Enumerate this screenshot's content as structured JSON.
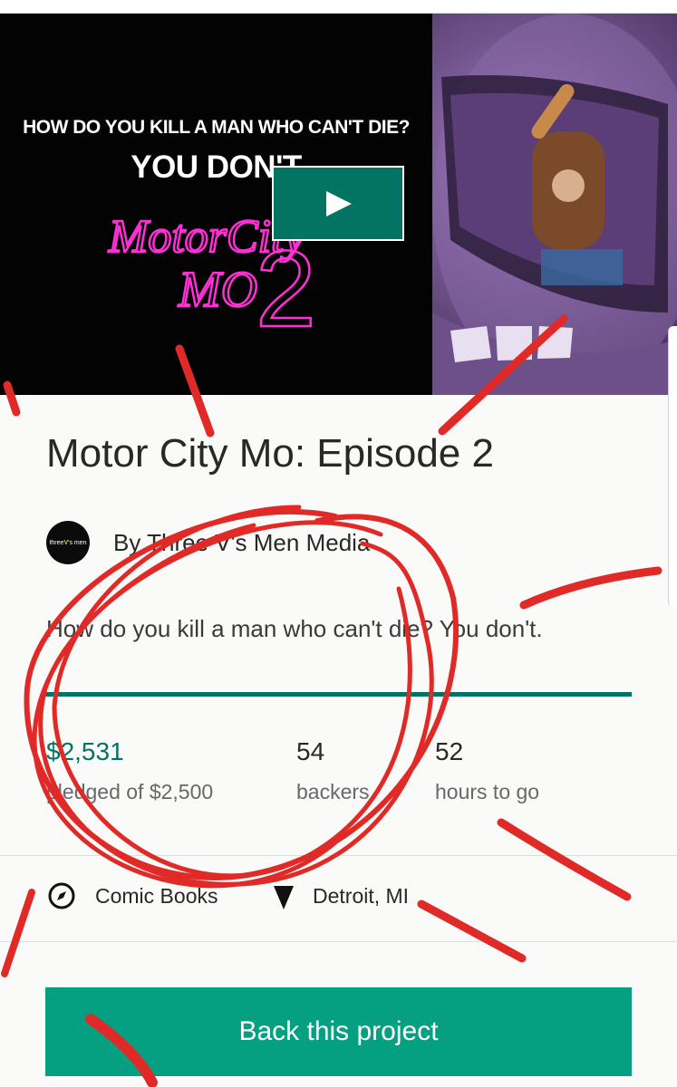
{
  "hero": {
    "question": "HOW DO YOU KILL A MAN WHO CAN'T DIE?",
    "answer": "YOU DON'T",
    "logo_line1": "MotorCity",
    "logo_line2": "MO",
    "logo_number": "2"
  },
  "project": {
    "title": "Motor City Mo: Episode 2",
    "creator": "By Three V's Men Media",
    "avatar_text_a": "three",
    "avatar_text_b": "V",
    "avatar_text_c": "'s men",
    "blurb": "How do you kill a man who can't die? You don't."
  },
  "stats": {
    "pledged_value": "$2,531",
    "pledged_label": "pledged of $2,500",
    "backers_value": "54",
    "backers_label": "backers",
    "time_value": "52",
    "time_label": "hours to go",
    "progress": 1.0
  },
  "meta": {
    "category": "Comic Books",
    "location": "Detroit, MI"
  },
  "cta": {
    "back_label": "Back this project"
  },
  "colors": {
    "accent": "#037362",
    "cta": "#05a081",
    "annotation": "#e02a27",
    "neon": "#ff2fd6"
  },
  "icons": {
    "play": "play-icon",
    "category": "compass-icon",
    "location": "location-pin-icon"
  }
}
